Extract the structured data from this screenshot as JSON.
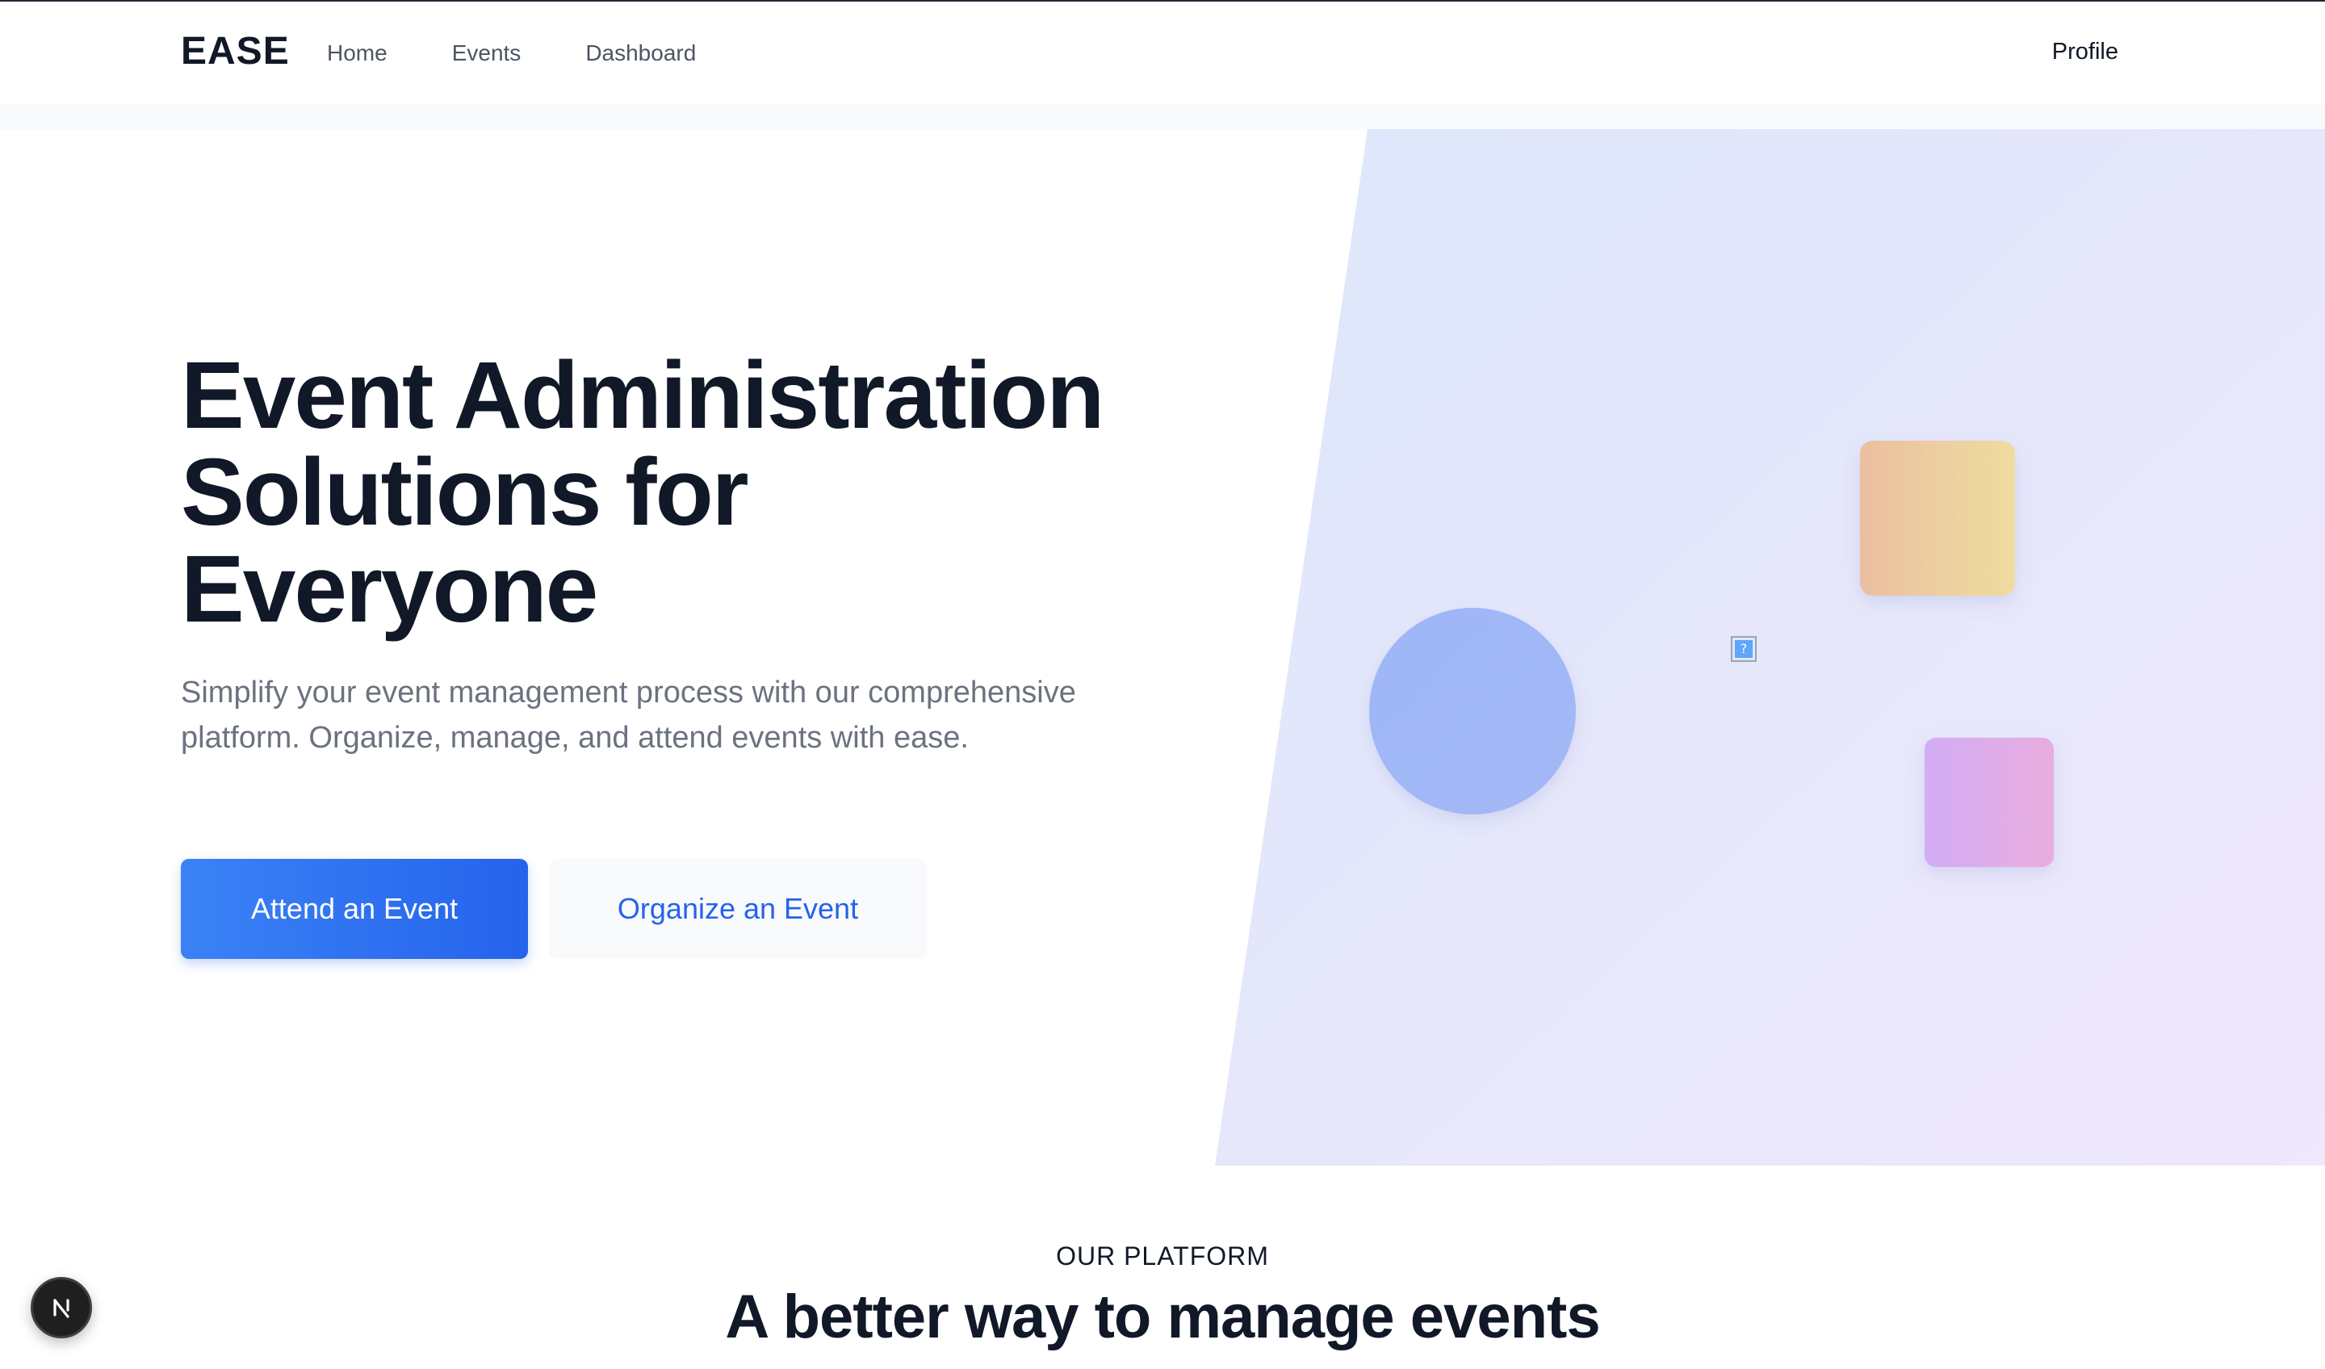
{
  "header": {
    "logo": "EASE",
    "nav": [
      {
        "label": "Home"
      },
      {
        "label": "Events"
      },
      {
        "label": "Dashboard"
      }
    ],
    "profile_label": "Profile"
  },
  "hero": {
    "title_lines": [
      "Event Administration",
      "Solutions for",
      "Everyone"
    ],
    "subtitle": "Simplify your event management process with our comprehensive platform. Organize, manage, and attend events with ease.",
    "primary_cta": "Attend an Event",
    "secondary_cta": "Organize an Event",
    "broken_image_glyph": "?"
  },
  "platform": {
    "eyebrow": "OUR PLATFORM",
    "title": "A better way to manage events"
  },
  "dev_badge": {
    "letter": "N"
  },
  "colors": {
    "accent": "#2563eb",
    "accent_light": "#3b82f6",
    "text_dark": "#111827",
    "text_muted": "#6b7280"
  }
}
